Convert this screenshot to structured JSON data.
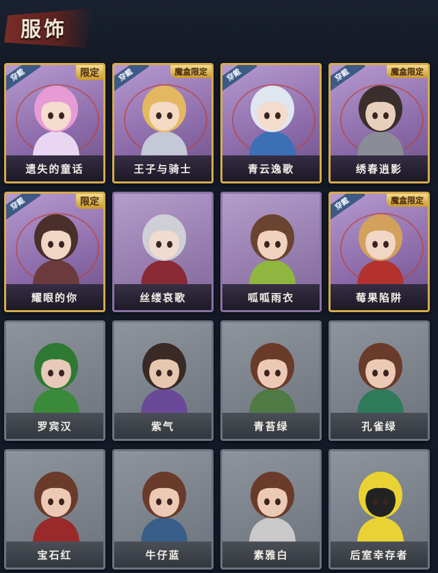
{
  "header": {
    "title": "服饰"
  },
  "badges": {
    "wear": "穿戴",
    "limited": "限定",
    "magic_box_limited": "魔盒限定"
  },
  "cards": [
    {
      "label": "遗失的童话",
      "wear": true,
      "tag": "limited",
      "style": "gold",
      "hair": "#e79bd4",
      "skin": "#f6dccf",
      "outfit": "#e9d6f2"
    },
    {
      "label": "王子与骑士",
      "wear": true,
      "tag": "magic_box_limited",
      "style": "gold",
      "hair": "#e3b860",
      "skin": "#f5dac5",
      "outfit": "#c5c8d6"
    },
    {
      "label": "青云逸歌",
      "wear": true,
      "tag": null,
      "style": "gold",
      "hair": "#dfe6ef",
      "skin": "#f4dccc",
      "outfit": "#3c6fb6"
    },
    {
      "label": "绣春逍影",
      "wear": true,
      "tag": "magic_box_limited",
      "style": "gold",
      "hair": "#3a2f2c",
      "skin": "#e8cfbd",
      "outfit": "#8a8c96"
    },
    {
      "label": "耀眼的你",
      "wear": true,
      "tag": "limited",
      "style": "gold",
      "hair": "#4a2f2a",
      "skin": "#f1d6c6",
      "outfit": "#6b3a3c"
    },
    {
      "label": "丝缕哀歌",
      "wear": false,
      "tag": null,
      "style": "purple",
      "hair": "#cfcfd7",
      "skin": "#f0dbd1",
      "outfit": "#8a2a35"
    },
    {
      "label": "呱呱雨衣",
      "wear": false,
      "tag": null,
      "style": "purple",
      "hair": "#6a4430",
      "skin": "#f0d2bf",
      "outfit": "#8fb63e"
    },
    {
      "label": "莓果陷阱",
      "wear": true,
      "tag": "magic_box_limited",
      "style": "gold",
      "hair": "#d2a15c",
      "skin": "#f1d6c6",
      "outfit": "#b3322e"
    },
    {
      "label": "罗宾汉",
      "wear": false,
      "tag": null,
      "style": "plain",
      "hair": "#2e7a32",
      "skin": "#e6c9b8",
      "outfit": "#3a8a3a"
    },
    {
      "label": "紫气",
      "wear": false,
      "tag": null,
      "style": "plain",
      "hair": "#3a2a26",
      "skin": "#e5c7b0",
      "outfit": "#6a4a98"
    },
    {
      "label": "青苔绿",
      "wear": false,
      "tag": null,
      "style": "plain",
      "hair": "#6a3b2a",
      "skin": "#ecc9b4",
      "outfit": "#4f7a44"
    },
    {
      "label": "孔雀绿",
      "wear": false,
      "tag": null,
      "style": "plain",
      "hair": "#6a3b2a",
      "skin": "#ecc9b4",
      "outfit": "#2e7a5a"
    },
    {
      "label": "宝石红",
      "wear": false,
      "tag": null,
      "style": "plain",
      "hair": "#6a3b2a",
      "skin": "#ecc9b4",
      "outfit": "#9a2a2a"
    },
    {
      "label": "牛仔蓝",
      "wear": false,
      "tag": null,
      "style": "plain",
      "hair": "#6a3b2a",
      "skin": "#ecc9b4",
      "outfit": "#3a5e8a"
    },
    {
      "label": "素雅白",
      "wear": false,
      "tag": null,
      "style": "plain",
      "hair": "#6a3b2a",
      "skin": "#ecc9b4",
      "outfit": "#c9c9c9"
    },
    {
      "label": "后室幸存者",
      "wear": false,
      "tag": null,
      "style": "plain",
      "hair": "#e9d233",
      "skin": "#222222",
      "outfit": "#e9d233"
    }
  ]
}
